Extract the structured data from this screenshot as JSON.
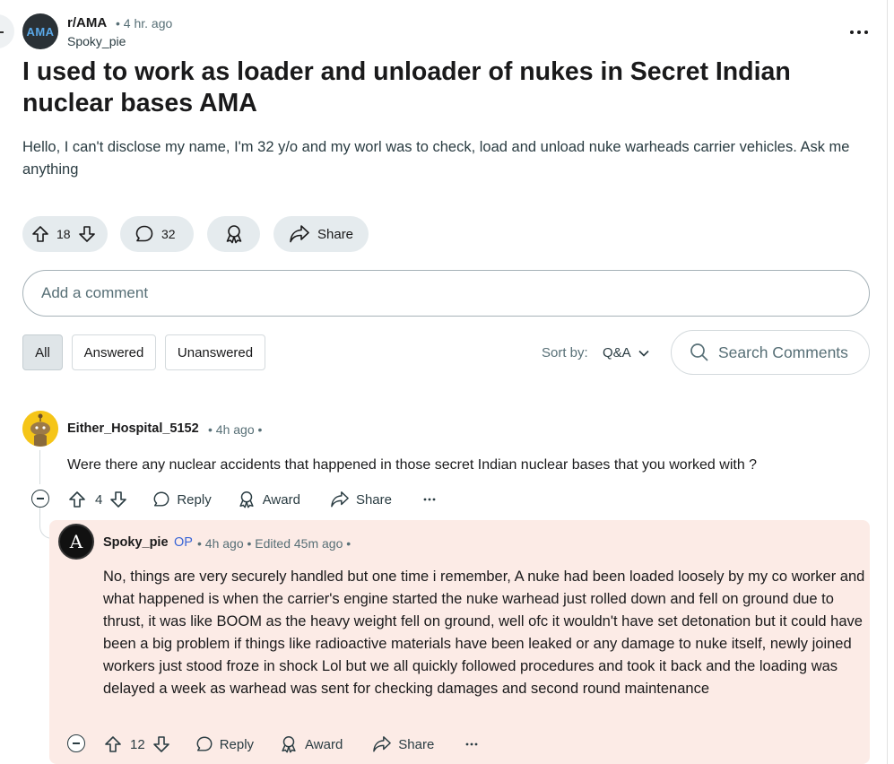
{
  "post": {
    "subreddit": "r/AMA",
    "subreddit_avatar_text": "AMA",
    "time": "• 4 hr. ago",
    "author": "Spoky_pie",
    "title": "I used to work as loader and unloader of nukes in Secret Indian nuclear bases AMA",
    "body": "Hello, I can't disclose my name, I'm 32 y/o and my worl was to check, load and unload nuke warheads carrier vehicles. Ask me anything",
    "upvotes": "18",
    "comments": "32",
    "share_label": "Share"
  },
  "comment_box": {
    "placeholder": "Add a comment"
  },
  "filters": {
    "all": "All",
    "answered": "Answered",
    "unanswered": "Unanswered"
  },
  "sort": {
    "label": "Sort by:",
    "value": "Q&A"
  },
  "search": {
    "placeholder": "Search Comments"
  },
  "comments": [
    {
      "author": "Either_Hospital_5152",
      "meta": "• 4h ago •",
      "body": "Were there any nuclear accidents that happened in those secret Indian nuclear bases that you worked with ?",
      "votes": "4",
      "reply": "Reply",
      "award": "Award",
      "share": "Share"
    },
    {
      "author": "Spoky_pie",
      "op_badge": "OP",
      "meta": "• 4h ago • Edited 45m ago •",
      "avatar_letter": "A",
      "body": "No, things are very securely handled but one time i remember, A nuke had been loaded loosely by my co worker and what happened is when the carrier's engine started the nuke warhead just rolled down and fell on ground due to thrust, it was like BOOM as the heavy weight fell on ground, well ofc it wouldn't have set detonation but it could have been a big problem if things like radioactive materials have been leaked or any damage to nuke itself, newly joined workers just stood froze in shock Lol but we all quickly followed procedures and took it back and the loading was delayed a week as warhead was sent for checking damages and second round maintenance",
      "votes": "12",
      "reply": "Reply",
      "award": "Award",
      "share": "Share"
    }
  ],
  "colors": {
    "op_badge": "#3b66d6",
    "thread_highlight": "#d0653a",
    "reply_background": "#fcebe6"
  }
}
